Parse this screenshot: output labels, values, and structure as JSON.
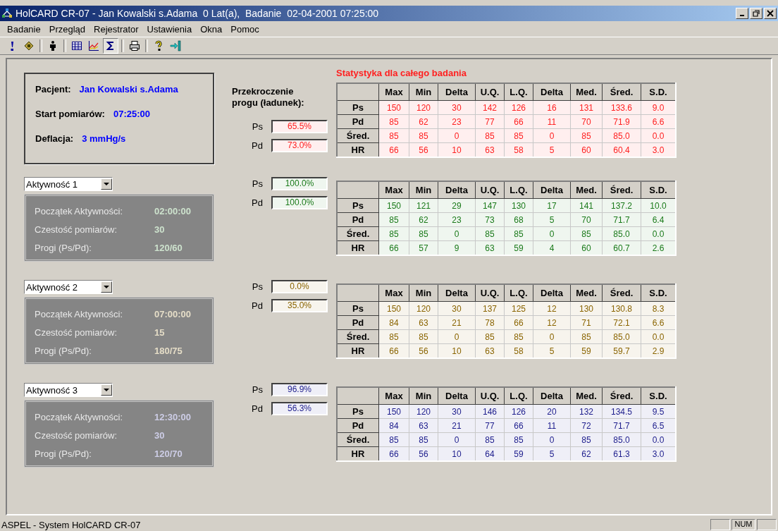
{
  "window": {
    "title": "HolCARD CR-07 - Jan Kowalski s.Adama  0 Lat(a),  Badanie  02-04-2001 07:25:00"
  },
  "menu": [
    "Badanie",
    "Przegląd",
    "Rejestrator",
    "Ustawienia",
    "Okna",
    "Pomoc"
  ],
  "toolbar": [
    {
      "selected": false
    },
    {
      "selected": false
    },
    {
      "selected": false
    },
    {
      "selected": false
    },
    {
      "selected": false
    },
    {
      "selected": true
    },
    {
      "selected": false
    },
    {
      "selected": false
    },
    {
      "selected": false
    }
  ],
  "summary": {
    "patient_label": "Pacjent:",
    "patient": "Jan Kowalski s.Adama",
    "start_label": "Start pomiarów:",
    "start": "07:25:00",
    "deflation_label": "Deflacja:",
    "deflation": "3 mmHg/s"
  },
  "threshold_title": "Przekroczenie progu (ładunek):",
  "sections": [
    {
      "kind": "overall",
      "title": "Statystyka dla całego badania",
      "color": "#ff2020",
      "ps_label": "Ps",
      "ps": "65.5%",
      "pd_label": "Pd",
      "pd": "73.0%",
      "table": {
        "columns": [
          "Max",
          "Min",
          "Delta",
          "U.Q.",
          "L.Q.",
          "Delta",
          "Med.",
          "Śred.",
          "S.D."
        ],
        "rows": [
          {
            "label": "Ps",
            "cells": [
              "150",
              "120",
              "30",
              "142",
              "126",
              "16",
              "131",
              "133.6",
              "9.0"
            ]
          },
          {
            "label": "Pd",
            "cells": [
              "85",
              "62",
              "23",
              "77",
              "66",
              "11",
              "70",
              "71.9",
              "6.6"
            ]
          },
          {
            "label": "Śred.",
            "cells": [
              "85",
              "85",
              "0",
              "85",
              "85",
              "0",
              "85",
              "85.0",
              "0.0"
            ]
          },
          {
            "label": "HR",
            "cells": [
              "66",
              "56",
              "10",
              "63",
              "58",
              "5",
              "60",
              "60.4",
              "3.0"
            ]
          }
        ]
      }
    },
    {
      "kind": "activity",
      "activity": "Aktywność 1",
      "color": "#1a7a1a",
      "fields": [
        {
          "label": "Początek Aktywności:",
          "value": "02:00:00"
        },
        {
          "label": "Czestość pomiarów:",
          "value": "30"
        },
        {
          "label": "Progi (Ps/Pd):",
          "value": "120/60"
        }
      ],
      "ps_label": "Ps",
      "ps": "100.0%",
      "pd_label": "Pd",
      "pd": "100.0%",
      "table": {
        "columns": [
          "Max",
          "Min",
          "Delta",
          "U.Q.",
          "L.Q.",
          "Delta",
          "Med.",
          "Śred.",
          "S.D."
        ],
        "rows": [
          {
            "label": "Ps",
            "cells": [
              "150",
              "121",
              "29",
              "147",
              "130",
              "17",
              "141",
              "137.2",
              "10.0"
            ]
          },
          {
            "label": "Pd",
            "cells": [
              "85",
              "62",
              "23",
              "73",
              "68",
              "5",
              "70",
              "71.7",
              "6.4"
            ]
          },
          {
            "label": "Śred.",
            "cells": [
              "85",
              "85",
              "0",
              "85",
              "85",
              "0",
              "85",
              "85.0",
              "0.0"
            ]
          },
          {
            "label": "HR",
            "cells": [
              "66",
              "57",
              "9",
              "63",
              "59",
              "4",
              "60",
              "60.7",
              "2.6"
            ]
          }
        ]
      }
    },
    {
      "kind": "activity",
      "activity": "Aktywność 2",
      "color": "#8a6400",
      "fields": [
        {
          "label": "Początek Aktywności:",
          "value": "07:00:00"
        },
        {
          "label": "Czestość pomiarów:",
          "value": "15"
        },
        {
          "label": "Progi (Ps/Pd):",
          "value": "180/75"
        }
      ],
      "ps_label": "Ps",
      "ps": "0.0%",
      "pd_label": "Pd",
      "pd": "35.0%",
      "table": {
        "columns": [
          "Max",
          "Min",
          "Delta",
          "U.Q.",
          "L.Q.",
          "Delta",
          "Med.",
          "Śred.",
          "S.D."
        ],
        "rows": [
          {
            "label": "Ps",
            "cells": [
              "150",
              "120",
              "30",
              "137",
              "125",
              "12",
              "130",
              "130.8",
              "8.3"
            ]
          },
          {
            "label": "Pd",
            "cells": [
              "84",
              "63",
              "21",
              "78",
              "66",
              "12",
              "71",
              "72.1",
              "6.6"
            ]
          },
          {
            "label": "Śred.",
            "cells": [
              "85",
              "85",
              "0",
              "85",
              "85",
              "0",
              "85",
              "85.0",
              "0.0"
            ]
          },
          {
            "label": "HR",
            "cells": [
              "66",
              "56",
              "10",
              "63",
              "58",
              "5",
              "59",
              "59.7",
              "2.9"
            ]
          }
        ]
      }
    },
    {
      "kind": "activity",
      "activity": "Aktywność 3",
      "color": "#1c1c8c",
      "fields": [
        {
          "label": "Początek Aktywności:",
          "value": "12:30:00"
        },
        {
          "label": "Czestość pomiarów:",
          "value": "30"
        },
        {
          "label": "Progi (Ps/Pd):",
          "value": "120/70"
        }
      ],
      "ps_label": "Ps",
      "ps": "96.9%",
      "pd_label": "Pd",
      "pd": "56.3%",
      "table": {
        "columns": [
          "Max",
          "Min",
          "Delta",
          "U.Q.",
          "L.Q.",
          "Delta",
          "Med.",
          "Śred.",
          "S.D."
        ],
        "rows": [
          {
            "label": "Ps",
            "cells": [
              "150",
              "120",
              "30",
              "146",
              "126",
              "20",
              "132",
              "134.5",
              "9.5"
            ]
          },
          {
            "label": "Pd",
            "cells": [
              "84",
              "63",
              "21",
              "77",
              "66",
              "11",
              "72",
              "71.7",
              "6.5"
            ]
          },
          {
            "label": "Śred.",
            "cells": [
              "85",
              "85",
              "0",
              "85",
              "85",
              "0",
              "85",
              "85.0",
              "0.0"
            ]
          },
          {
            "label": "HR",
            "cells": [
              "66",
              "56",
              "10",
              "64",
              "59",
              "5",
              "62",
              "61.3",
              "3.0"
            ]
          }
        ]
      }
    }
  ],
  "status_bar": {
    "text": "ASPEL - System HolCARD CR-07",
    "indicator": "NUM"
  }
}
